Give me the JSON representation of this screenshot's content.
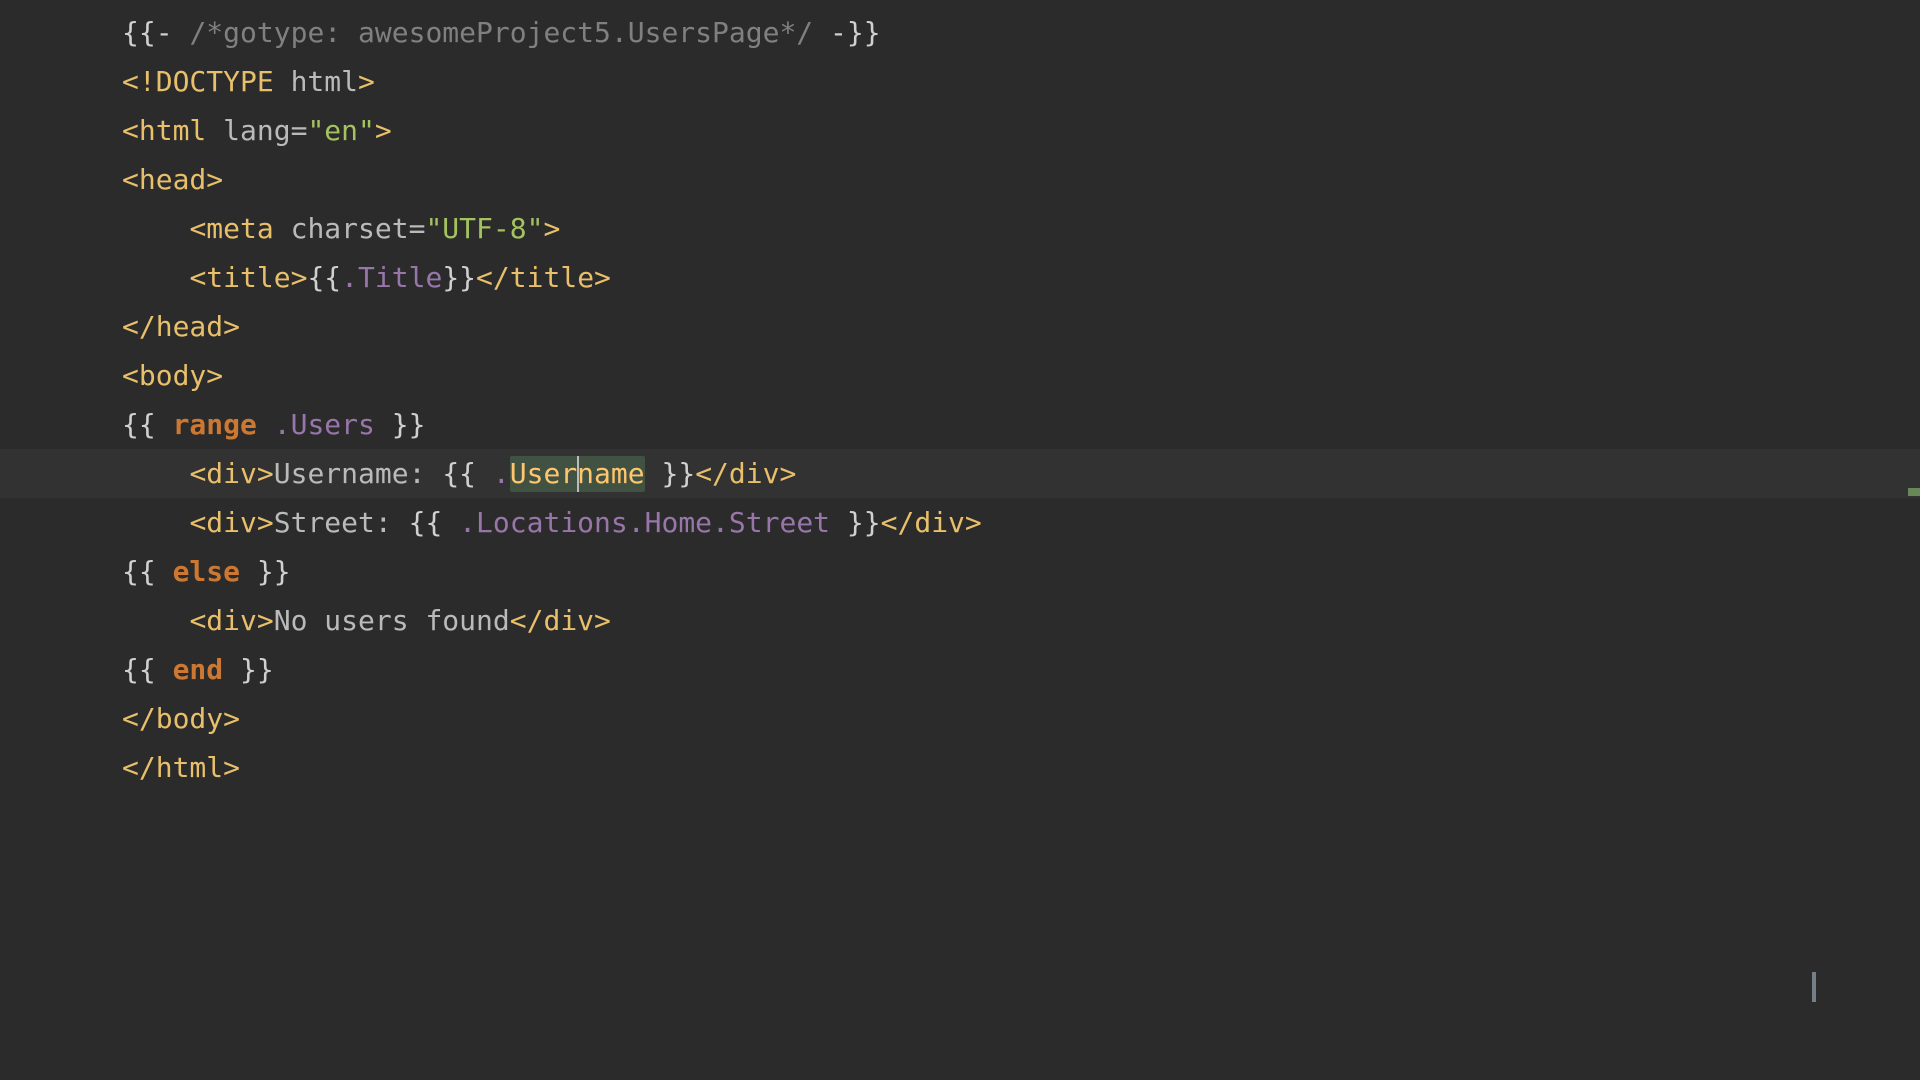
{
  "code": {
    "lines": [
      {
        "indent": 0,
        "segments": [
          {
            "cls": "t-delim",
            "text": "{{- "
          },
          {
            "cls": "t-comment",
            "text": "/*gotype: awesomeProject5.UsersPage*/"
          },
          {
            "cls": "t-delim",
            "text": " -}}"
          }
        ]
      },
      {
        "indent": 0,
        "segments": [
          {
            "cls": "t-tag",
            "text": "<!DOCTYPE "
          },
          {
            "cls": "t-attr",
            "text": "html"
          },
          {
            "cls": "t-tag",
            "text": ">"
          }
        ]
      },
      {
        "indent": 0,
        "segments": [
          {
            "cls": "t-tag",
            "text": "<html "
          },
          {
            "cls": "t-attr",
            "text": "lang="
          },
          {
            "cls": "t-string",
            "text": "\"en\""
          },
          {
            "cls": "t-tag",
            "text": ">"
          }
        ]
      },
      {
        "indent": 0,
        "segments": [
          {
            "cls": "t-tag",
            "text": "<head>"
          }
        ]
      },
      {
        "indent": 1,
        "segments": [
          {
            "cls": "t-tag",
            "text": "<meta "
          },
          {
            "cls": "t-attr",
            "text": "charset="
          },
          {
            "cls": "t-string",
            "text": "\"UTF-8\""
          },
          {
            "cls": "t-tag",
            "text": ">"
          }
        ]
      },
      {
        "indent": 1,
        "segments": [
          {
            "cls": "t-tag",
            "text": "<title>"
          },
          {
            "cls": "t-delim",
            "text": "{{"
          },
          {
            "cls": "t-var",
            "text": ".Title"
          },
          {
            "cls": "t-delim",
            "text": "}}"
          },
          {
            "cls": "t-tag",
            "text": "</title>"
          }
        ]
      },
      {
        "indent": 0,
        "segments": [
          {
            "cls": "t-tag",
            "text": "</head>"
          }
        ]
      },
      {
        "indent": 0,
        "segments": [
          {
            "cls": "t-tag",
            "text": "<body>"
          }
        ]
      },
      {
        "indent": 0,
        "segments": [
          {
            "cls": "t-delim",
            "text": "{{ "
          },
          {
            "cls": "t-keyword",
            "text": "range"
          },
          {
            "cls": "t-delim",
            "text": " "
          },
          {
            "cls": "t-var",
            "text": ".Users"
          },
          {
            "cls": "t-delim",
            "text": " }}"
          }
        ]
      },
      {
        "indent": 1,
        "segments": [
          {
            "cls": "t-tag",
            "text": "<div>"
          },
          {
            "cls": "t-text",
            "text": "Username: "
          },
          {
            "cls": "t-delim",
            "text": "{{ "
          },
          {
            "cls": "t-var",
            "text": "."
          },
          {
            "cls": "t-ident",
            "text": "Username"
          },
          {
            "cls": "t-delim",
            "text": " }}"
          },
          {
            "cls": "t-tag",
            "text": "</div>"
          }
        ]
      },
      {
        "indent": 1,
        "segments": [
          {
            "cls": "t-tag",
            "text": "<div>"
          },
          {
            "cls": "t-text",
            "text": "Street: "
          },
          {
            "cls": "t-delim",
            "text": "{{ "
          },
          {
            "cls": "t-var",
            "text": ".Locations.Home.Street"
          },
          {
            "cls": "t-delim",
            "text": " }}"
          },
          {
            "cls": "t-tag",
            "text": "</div>"
          }
        ]
      },
      {
        "indent": 0,
        "segments": [
          {
            "cls": "t-delim",
            "text": "{{ "
          },
          {
            "cls": "t-keyword",
            "text": "else"
          },
          {
            "cls": "t-delim",
            "text": " }}"
          }
        ]
      },
      {
        "indent": 1,
        "segments": [
          {
            "cls": "t-tag",
            "text": "<div>"
          },
          {
            "cls": "t-text",
            "text": "No users found"
          },
          {
            "cls": "t-tag",
            "text": "</div>"
          }
        ]
      },
      {
        "indent": 0,
        "segments": [
          {
            "cls": "t-delim",
            "text": "{{ "
          },
          {
            "cls": "t-keyword",
            "text": "end"
          },
          {
            "cls": "t-delim",
            "text": " }}"
          }
        ]
      },
      {
        "indent": 0,
        "segments": [
          {
            "cls": "t-tag",
            "text": "</body>"
          }
        ]
      },
      {
        "indent": 0,
        "segments": [
          {
            "cls": "t-tag",
            "text": "</html>"
          }
        ]
      }
    ]
  },
  "highlight": {
    "lineIndex": 9,
    "wordStartCol": 23,
    "wordLen": 8,
    "caretCol": 27
  },
  "status": {
    "ok": true
  },
  "layout": {
    "indentSpaces": "    "
  }
}
